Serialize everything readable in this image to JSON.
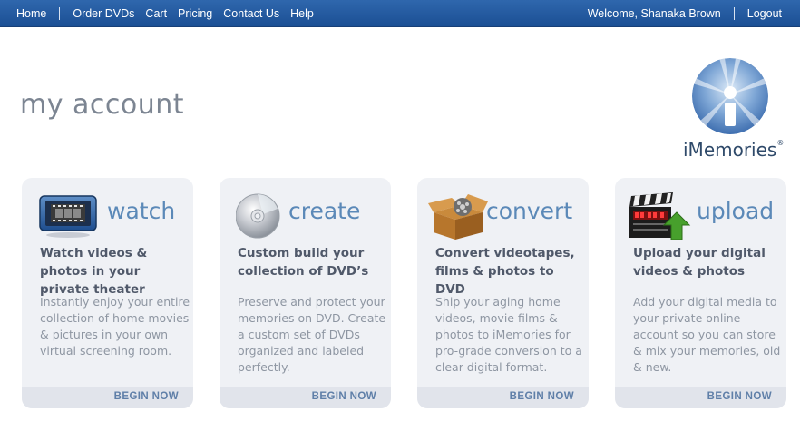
{
  "nav": {
    "left": [
      "Home",
      "Order DVDs",
      "Cart",
      "Pricing",
      "Contact Us",
      "Help"
    ],
    "welcome": "Welcome, Shanaka Brown",
    "logout": "Logout"
  },
  "page": {
    "title": "my account"
  },
  "logo": {
    "name": "iMemories",
    "mark": "®"
  },
  "cards": [
    {
      "icon": "film-screen-icon",
      "heading": "watch",
      "subheading": "Watch videos & photos in your private theater",
      "description": "Instantly enjoy your entire collection of home movies & pictures in your own virtual screening room.",
      "cta": "BEGIN NOW"
    },
    {
      "icon": "dvd-disc-icon",
      "heading": "create",
      "subheading": "Custom build your collection of DVD’s",
      "description": "Preserve and protect your memories on DVD. Create a custom set of DVDs organized and labeled perfectly.",
      "cta": "BEGIN NOW"
    },
    {
      "icon": "box-film-reel-icon",
      "heading": "convert",
      "subheading": "Convert videotapes, films & photos to DVD",
      "description": "Ship your aging home videos, movie films & photos to iMemories for pro-grade conversion to a clear digital format.",
      "cta": "BEGIN NOW"
    },
    {
      "icon": "clapperboard-upload-icon",
      "heading": "upload",
      "subheading": "Upload your digital videos & photos",
      "description": "Add your digital media to your private online account so you can store & mix your memories, old & new.",
      "cta": "BEGIN NOW"
    }
  ],
  "colors": {
    "nav_bar": "#1f5699",
    "heading_blue": "#5b89b8",
    "card_bg": "#eff1f5",
    "cta_blue": "#5f7fa8"
  }
}
